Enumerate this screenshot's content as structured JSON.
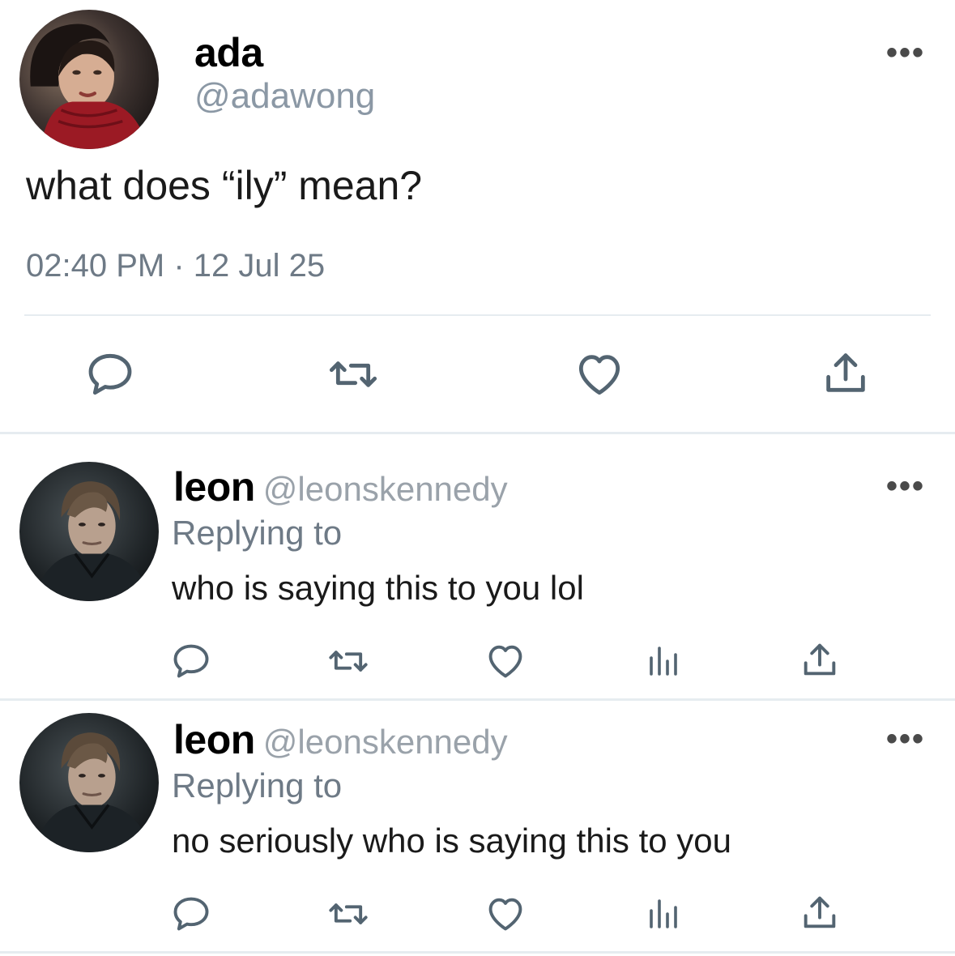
{
  "main_tweet": {
    "name": "ada",
    "handle": "@adawong",
    "text": "what does “ily” mean?",
    "timestamp": "02:40 PM · 12 Jul 25",
    "more": "•••",
    "avatar_icon": "avatar-ada",
    "action_icons": [
      "reply-icon",
      "retweet-icon",
      "like-icon",
      "share-icon"
    ]
  },
  "replies": [
    {
      "name": "leon",
      "handle": "@leonskennedy",
      "replying": "Replying to",
      "text": "who is saying this to you lol",
      "more": "•••",
      "action_icons": [
        "reply-icon",
        "retweet-icon",
        "like-icon",
        "analytics-icon",
        "share-icon"
      ]
    },
    {
      "name": "leon",
      "handle": "@leonskennedy",
      "replying": "Replying to",
      "text": "no seriously who is saying this to you",
      "more": "•••",
      "action_icons": [
        "reply-icon",
        "retweet-icon",
        "like-icon",
        "analytics-icon",
        "share-icon"
      ]
    }
  ],
  "colors": {
    "icon": "#536471",
    "secondary_text": "#6e7a86",
    "divider": "#e6ecf0"
  }
}
